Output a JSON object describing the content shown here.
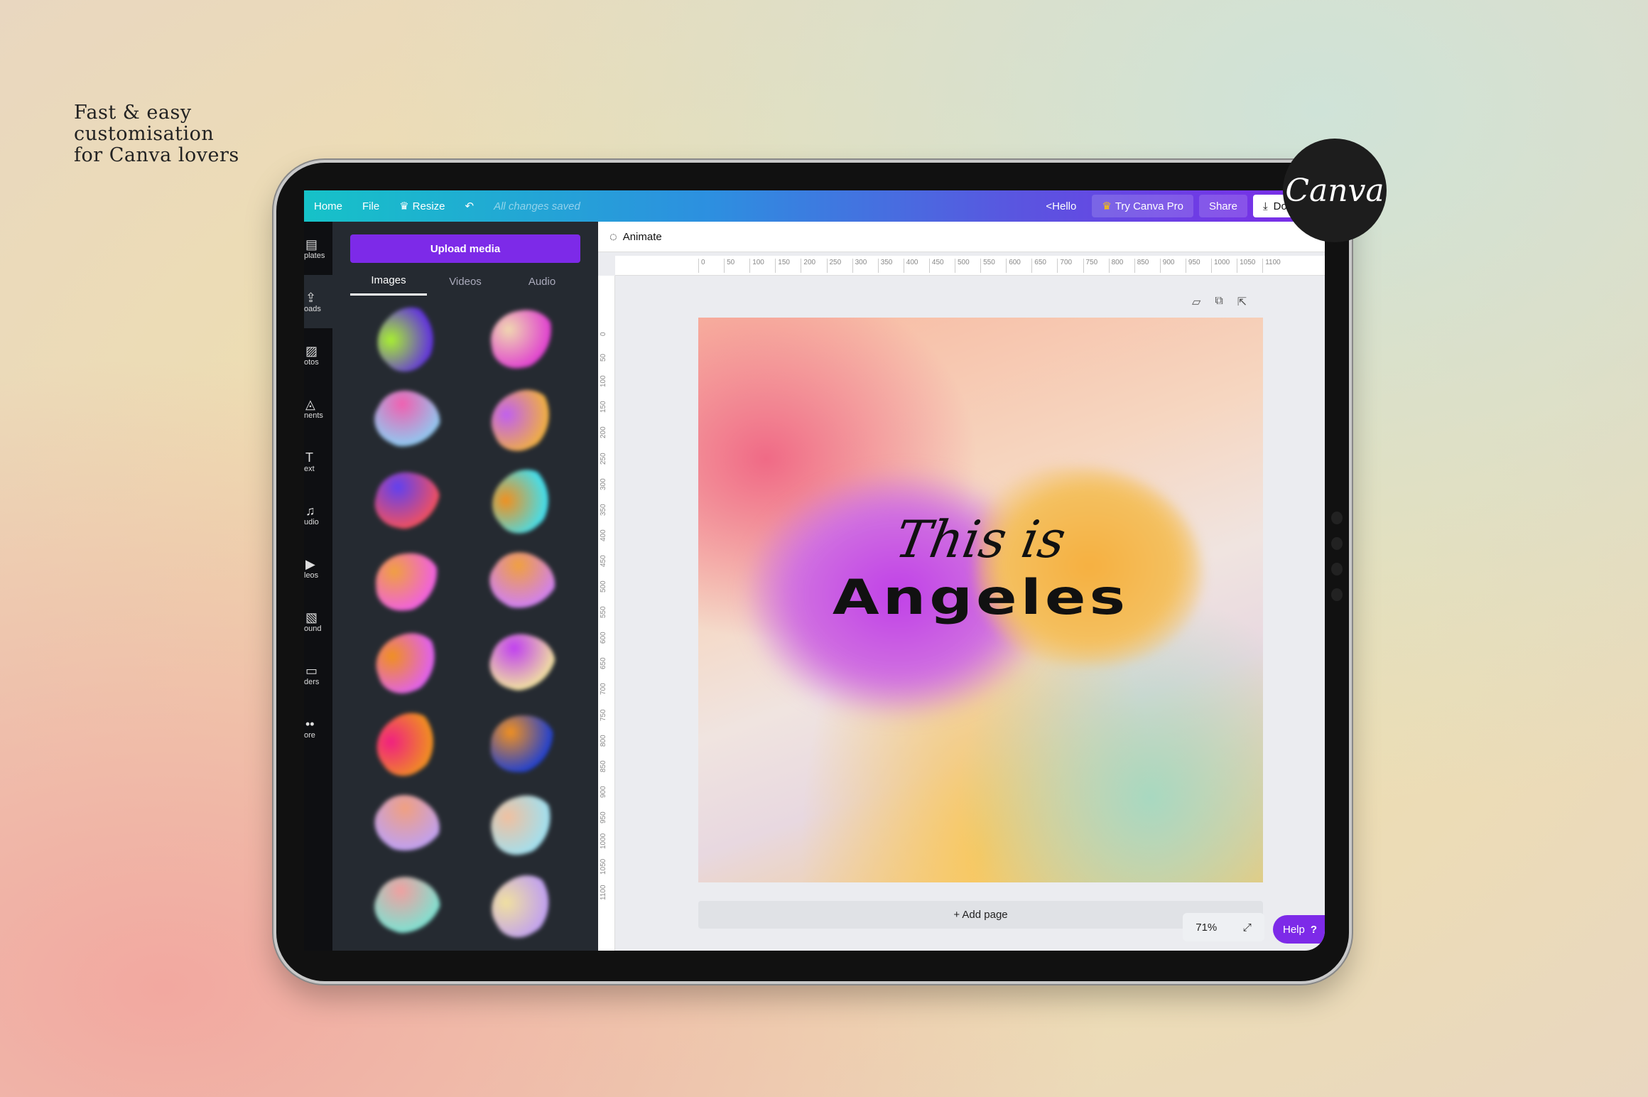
{
  "tagline": [
    "Fast & easy",
    "customisation",
    "for Canva lovers"
  ],
  "logo_text": "Canva",
  "topbar": {
    "home": "Home",
    "file": "File",
    "resize": "Resize",
    "undo_icon": "undo-arrow",
    "saved": "All changes saved",
    "hello": "<Hello",
    "try_pro": "Try Canva Pro",
    "share": "Share",
    "download": "Downloa"
  },
  "rail": [
    {
      "icon": "▤",
      "label": "plates"
    },
    {
      "icon": "⇪",
      "label": "oads"
    },
    {
      "icon": "▨",
      "label": "otos"
    },
    {
      "icon": "◬",
      "label": "nents"
    },
    {
      "icon": "T",
      "label": "ext"
    },
    {
      "icon": "♫",
      "label": "udio"
    },
    {
      "icon": "▶",
      "label": "leos"
    },
    {
      "icon": "▧",
      "label": "ound"
    },
    {
      "icon": "▭",
      "label": "ders"
    },
    {
      "icon": "••",
      "label": "ore"
    }
  ],
  "panel": {
    "upload": "Upload media",
    "tabs": [
      "Images",
      "Videos",
      "Audio"
    ],
    "active_tab": "Images"
  },
  "thumbnails": [
    [
      "#a8f030",
      "#6030e0"
    ],
    [
      "#f0d8b0",
      "#e040d0"
    ],
    [
      "#f060b0",
      "#90c8f0"
    ],
    [
      "#c060f0",
      "#f0b040"
    ],
    [
      "#6040f0",
      "#f05060"
    ],
    [
      "#f09020",
      "#40e0f0"
    ],
    [
      "#f0a040",
      "#f060e0"
    ],
    [
      "#f0a040",
      "#d080f0"
    ],
    [
      "#f09020",
      "#e060f0"
    ],
    [
      "#c040f0",
      "#f0e0a0"
    ],
    [
      "#f02080",
      "#f09020"
    ],
    [
      "#f09020",
      "#2040d0"
    ],
    [
      "#f0a080",
      "#c0a0f0"
    ],
    [
      "#f0c0a0",
      "#a0e0f0"
    ],
    [
      "#f0a0a0",
      "#80e0d0"
    ],
    [
      "#f0e0a0",
      "#c0a0f0"
    ]
  ],
  "canvas": {
    "animate": "Animate",
    "ruler_h": [
      "0",
      "50",
      "100",
      "150",
      "200",
      "250",
      "300",
      "350",
      "400",
      "450",
      "500",
      "550",
      "600",
      "650",
      "700",
      "750",
      "800",
      "850",
      "900",
      "950",
      "1000",
      "1050",
      "1100"
    ],
    "ruler_v": [
      "0",
      "50",
      "100",
      "150",
      "200",
      "250",
      "300",
      "350",
      "400",
      "450",
      "500",
      "550",
      "600",
      "650",
      "700",
      "750",
      "800",
      "850",
      "900",
      "950",
      "1000",
      "1050",
      "1100"
    ],
    "line1": "This is",
    "line2": "Angeles",
    "add_page": "+ Add page",
    "zoom": "71%",
    "help": "Help",
    "help_icon": "?"
  },
  "colors": {
    "accent": "#7d2ae8",
    "panel": "#252a31"
  }
}
